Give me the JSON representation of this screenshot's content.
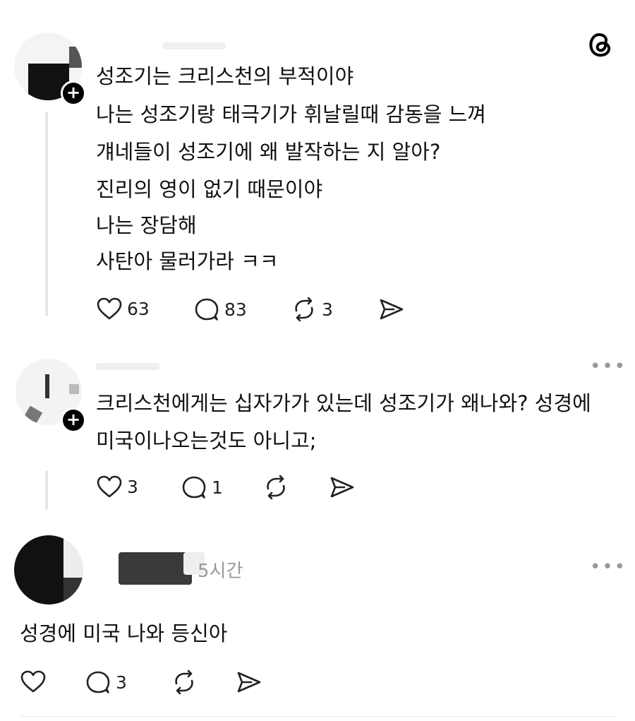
{
  "app": {
    "logo": "threads-logo-icon"
  },
  "posts": [
    {
      "lines": [
        "성조기는 크리스천의 부적이야",
        "나는 성조기랑 태극기가 휘날릴때 감동을 느껴",
        "걔네들이 성조기에 왜 발작하는 지 알아?",
        "진리의 영이 없기 때문이야",
        "나는 장담해",
        "사탄아 물러가라 ㅋㅋ"
      ],
      "likes": "63",
      "comments": "83",
      "reposts": "3"
    },
    {
      "text": "크리스천에게는 십자가가 있는데 성조기가 왜나와? 성경에 미국이나오는것도 아니고;",
      "likes": "3",
      "comments": "1",
      "reposts": ""
    },
    {
      "time": "5시간",
      "text": "성경에 미국 나와 등신아",
      "likes": "",
      "comments": "3",
      "reposts": ""
    }
  ],
  "colors": {
    "text": "#111111",
    "muted": "#999999",
    "line": "#e6e6e6"
  }
}
